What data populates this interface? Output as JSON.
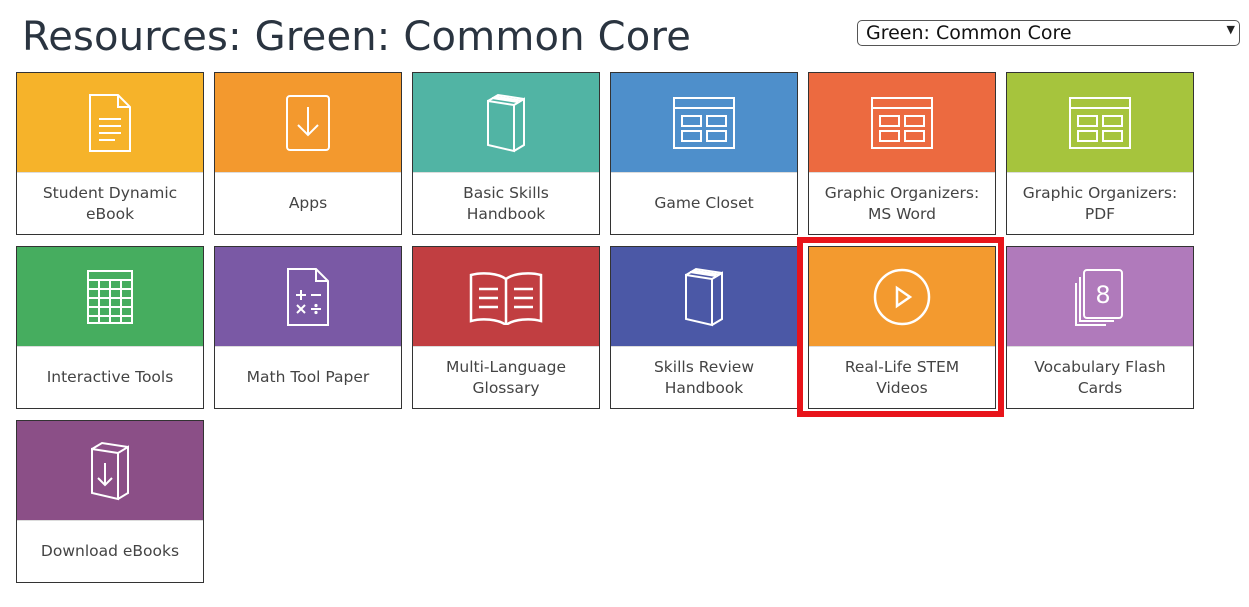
{
  "header": {
    "title": "Resources: Green: Common Core"
  },
  "program_select": {
    "selected": "Green: Common Core"
  },
  "tiles": [
    {
      "label": "Student Dynamic eBook",
      "color": "#f6b32a",
      "icon": "document-icon"
    },
    {
      "label": "Apps",
      "color": "#f3992e",
      "icon": "download-icon"
    },
    {
      "label": "Basic Skills Handbook",
      "color": "#51b4a4",
      "icon": "book-icon"
    },
    {
      "label": "Game Closet",
      "color": "#4e8fcb",
      "icon": "grid-window-icon"
    },
    {
      "label": "Graphic Organizers: MS Word",
      "color": "#ec6a40",
      "icon": "grid-window-icon"
    },
    {
      "label": "Graphic Organizers: PDF",
      "color": "#a6c43d",
      "icon": "grid-window-icon"
    },
    {
      "label": "Interactive Tools",
      "color": "#46ad5f",
      "icon": "spreadsheet-icon"
    },
    {
      "label": "Math Tool Paper",
      "color": "#7a59a5",
      "icon": "calculator-icon"
    },
    {
      "label": "Multi-Language Glossary",
      "color": "#c13e41",
      "icon": "open-book-icon"
    },
    {
      "label": "Skills Review Handbook",
      "color": "#4b58a6",
      "icon": "book-icon"
    },
    {
      "label": "Real-Life STEM Videos",
      "color": "#f39a2f",
      "icon": "play-icon",
      "highlighted": true
    },
    {
      "label": "Vocabulary Flash Cards",
      "color": "#b07abb",
      "icon": "flash-cards-icon"
    },
    {
      "label": "Download eBooks",
      "color": "#8b4f87",
      "icon": "book-download-icon"
    }
  ]
}
